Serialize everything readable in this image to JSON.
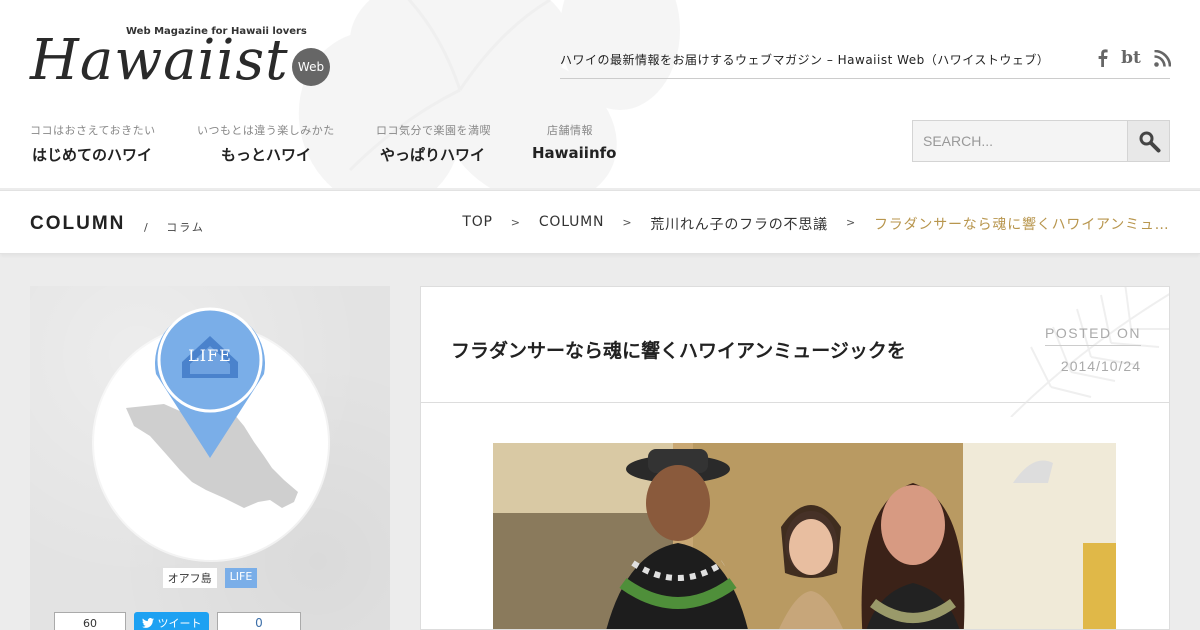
{
  "header": {
    "logo_tagline": "Web Magazine for Hawaii lovers",
    "logo_text": "Hawaiist",
    "logo_badge": "Web",
    "tagline": "ハワイの最新情報をお届けするウェブマガジン – Hawaiist Web（ハワイストウェブ）",
    "social": [
      {
        "icon": "facebook-icon",
        "label": "f"
      },
      {
        "icon": "bt-icon",
        "label": "bt"
      },
      {
        "icon": "rss-icon",
        "label": "rss"
      }
    ]
  },
  "nav": [
    {
      "sub": "ココはおさえておきたい",
      "main": "はじめてのハワイ"
    },
    {
      "sub": "いつもとは違う楽しみかた",
      "main": "もっとハワイ"
    },
    {
      "sub": "ロコ気分で楽園を満喫",
      "main": "やっぱりハワイ"
    },
    {
      "sub": "店舗情報",
      "main": "Hawaiinfo"
    }
  ],
  "search": {
    "placeholder": "SEARCH..."
  },
  "section": {
    "title": "COLUMN",
    "slash": "/",
    "subtitle": "コラム"
  },
  "breadcrumb": {
    "items": [
      "TOP",
      "COLUMN",
      "荒川れん子のフラの不思議"
    ],
    "separator": ">",
    "current": "フラダンサーなら魂に響くハワイアンミュージックを"
  },
  "sidebar": {
    "pin_label": "LIFE",
    "area_tag": "オアフ島",
    "category_tag": "LIFE",
    "share_count_left": "60",
    "tweet_label": "ツイート",
    "share_count_right": "0",
    "colors": {
      "pin": "#7aaee8",
      "pin_dark": "#3f7fd0",
      "island": "#c9c9c9"
    }
  },
  "article": {
    "title": "フラダンサーなら魂に響くハワイアンミュージックを",
    "posted_on_label": "POSTED ON",
    "posted_date": "2014/10/24"
  }
}
